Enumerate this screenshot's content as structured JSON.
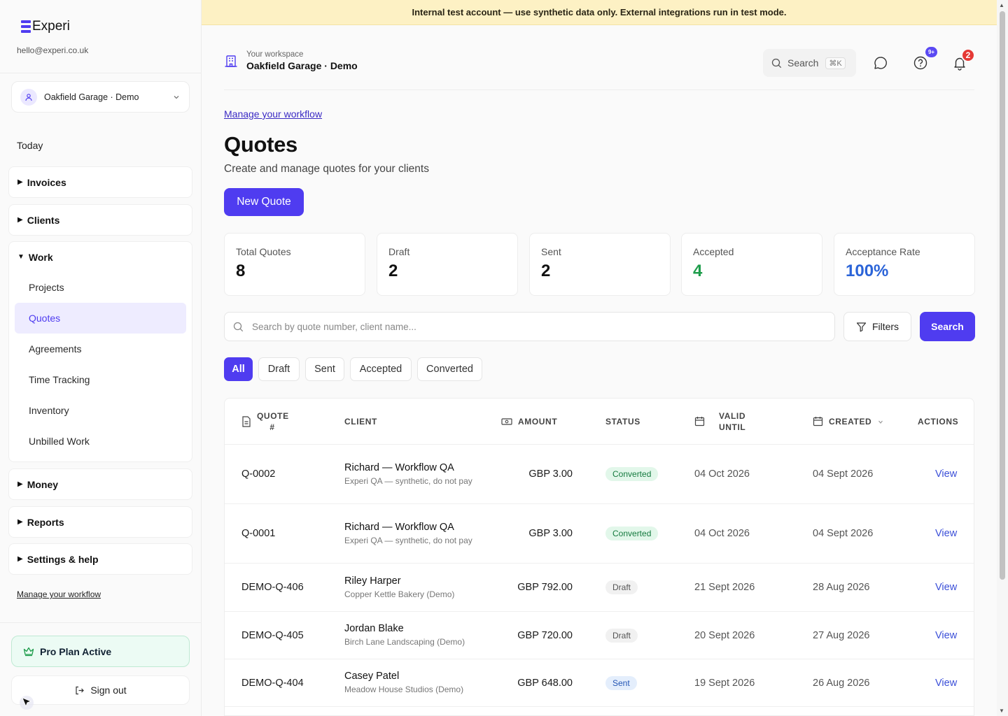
{
  "app": {
    "name": "Experi",
    "email": "hello@experi.co.uk"
  },
  "workspace": {
    "label": "Your workspace",
    "name": "Oakfield Garage · Demo"
  },
  "banner": "Internal test account — use synthetic data only. External integrations run in test mode.",
  "sidebar": {
    "today": "Today",
    "groups": [
      {
        "label": "Invoices",
        "expanded": false
      },
      {
        "label": "Clients",
        "expanded": false
      },
      {
        "label": "Work",
        "expanded": true,
        "items": [
          "Projects",
          "Quotes",
          "Agreements",
          "Time Tracking",
          "Inventory",
          "Unbilled Work"
        ],
        "active": "Quotes"
      },
      {
        "label": "Money",
        "expanded": false
      },
      {
        "label": "Reports",
        "expanded": false
      },
      {
        "label": "Settings & help",
        "expanded": false
      }
    ],
    "manage_link": "Manage your workflow",
    "pro_plan": "Pro Plan Active",
    "sign_out": "Sign out"
  },
  "header": {
    "search_label": "Search",
    "search_shortcut": "⌘K",
    "help_badge": "9+",
    "notif_badge": "2"
  },
  "main": {
    "manage_link": "Manage your workflow",
    "title": "Quotes",
    "subtitle": "Create and manage quotes for your clients",
    "new_quote": "New Quote"
  },
  "stats": [
    {
      "label": "Total Quotes",
      "value": "8",
      "color": "#111111"
    },
    {
      "label": "Draft",
      "value": "2",
      "color": "#111111"
    },
    {
      "label": "Sent",
      "value": "2",
      "color": "#111111"
    },
    {
      "label": "Accepted",
      "value": "4",
      "color": "#1f9d4c"
    },
    {
      "label": "Acceptance Rate",
      "value": "100%",
      "color": "#2b64d8"
    }
  ],
  "search": {
    "placeholder": "Search by quote number, client name...",
    "filters_label": "Filters",
    "button_label": "Search"
  },
  "tabs": [
    "All",
    "Draft",
    "Sent",
    "Accepted",
    "Converted"
  ],
  "active_tab": "All",
  "table": {
    "headers": {
      "quote": "QUOTE #",
      "client": "CLIENT",
      "amount": "AMOUNT",
      "status": "STATUS",
      "valid_until": "VALID UNTIL",
      "created": "CREATED",
      "actions": "ACTIONS"
    },
    "rows": [
      {
        "quote": "Q-0002",
        "client": "Richard — Workflow QA",
        "client_sub": "Experi QA — synthetic, do not pay",
        "amount": "GBP 3.00",
        "status": "Converted",
        "valid_until": "04 Oct 2026",
        "created": "04 Sept 2026",
        "action": "View"
      },
      {
        "quote": "Q-0001",
        "client": "Richard — Workflow QA",
        "client_sub": "Experi QA — synthetic, do not pay",
        "amount": "GBP 3.00",
        "status": "Converted",
        "valid_until": "04 Oct 2026",
        "created": "04 Sept 2026",
        "action": "View"
      },
      {
        "quote": "DEMO-Q-406",
        "client": "Riley Harper",
        "client_sub": "Copper Kettle Bakery (Demo)",
        "amount": "GBP 792.00",
        "status": "Draft",
        "valid_until": "21 Sept 2026",
        "created": "28 Aug 2026",
        "action": "View"
      },
      {
        "quote": "DEMO-Q-405",
        "client": "Jordan Blake",
        "client_sub": "Birch Lane Landscaping (Demo)",
        "amount": "GBP 720.00",
        "status": "Draft",
        "valid_until": "20 Sept 2026",
        "created": "27 Aug 2026",
        "action": "View"
      },
      {
        "quote": "DEMO-Q-404",
        "client": "Casey Patel",
        "client_sub": "Meadow House Studios (Demo)",
        "amount": "GBP 648.00",
        "status": "Sent",
        "valid_until": "19 Sept 2026",
        "created": "26 Aug 2026",
        "action": "View"
      }
    ]
  },
  "colors": {
    "accent": "#4f3cf0",
    "banner": "#fdf1c4"
  }
}
